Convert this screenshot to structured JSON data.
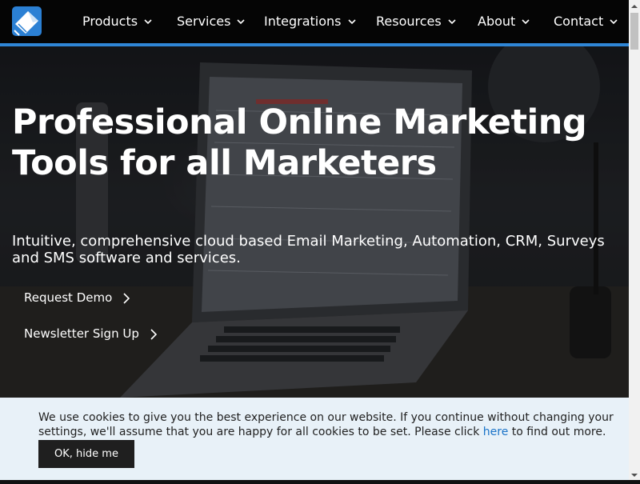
{
  "nav": {
    "logo_icon": "envelope-logo-icon",
    "items": [
      {
        "label": "Products"
      },
      {
        "label": "Services"
      },
      {
        "label": "Integrations"
      },
      {
        "label": "Resources"
      },
      {
        "label": "About"
      },
      {
        "label": "Contact"
      }
    ]
  },
  "hero": {
    "headline": "Professional Online Marketing Tools for all Marketers",
    "subline": "Intuitive, comprehensive cloud based Email Marketing, Automation, CRM, Surveys and SMS software and services.",
    "ctas": [
      {
        "label": "Request Demo"
      },
      {
        "label": "Newsletter Sign Up"
      }
    ]
  },
  "cookie": {
    "text_before": "We use cookies to give you the best experience on our website. If you continue without changing your settings, we'll assume that you are happy for all cookies to be set. Please click",
    "link_label": "here",
    "text_after": "to find out more.",
    "button_label": "OK, hide me"
  },
  "colors": {
    "accent": "#2f86d6",
    "nav_bg": "#050505",
    "cookie_bg": "#e8f1f8",
    "link": "#1a73c8"
  }
}
